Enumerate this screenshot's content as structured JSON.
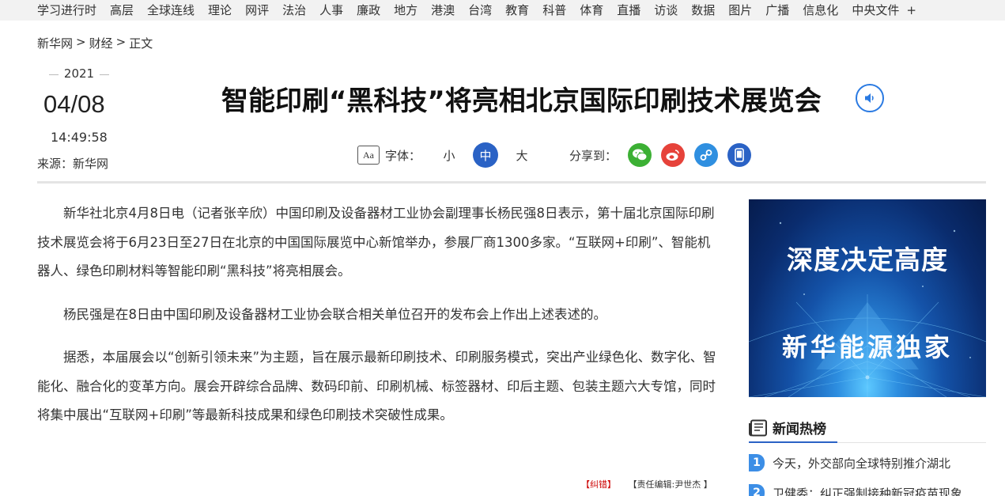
{
  "topnav": {
    "items": [
      "学习进行时",
      "高层",
      "全球连线",
      "理论",
      "网评",
      "法治",
      "人事",
      "廉政",
      "地方",
      "港澳",
      "台湾",
      "教育",
      "科普",
      "体育",
      "直播",
      "访谈",
      "数据",
      "图片",
      "广播",
      "信息化",
      "中央文件"
    ],
    "more": "+"
  },
  "breadcrumb": {
    "site": "新华网",
    "sep": ">",
    "section": "财经",
    "page": "正文"
  },
  "date": {
    "year": "2021",
    "month_day": "04/08",
    "time": "14:49:58"
  },
  "source": "来源：新华网",
  "headline": "智能印刷“黑科技”将亮相北京国际印刷技术展览会",
  "toolbar": {
    "font_label": "字体：",
    "sizes": [
      "小",
      "中",
      "大"
    ],
    "active_size": "中",
    "share_label": "分享到：",
    "share_icons": [
      "wechat-icon",
      "weibo-icon",
      "link-icon",
      "mobile-icon"
    ],
    "share_colors": [
      "#3cb034",
      "#e6423a",
      "#2f8fe0",
      "#2a62c5"
    ]
  },
  "article": {
    "paragraphs": [
      "新华社北京4月8日电（记者张辛欣）中国印刷及设备器材工业协会副理事长杨民强8日表示，第十届北京国际印刷技术展览会将于6月23日至27日在北京的中国国际展览中心新馆举办，参展厂商1300多家。“互联网+印刷”、智能机器人、绿色印刷材料等智能印刷“黑科技”将亮相展会。",
      "杨民强是在8日由中国印刷及设备器材工业协会联合相关单位召开的发布会上作出上述表述的。",
      "据悉，本届展会以“创新引领未来”为主题，旨在展示最新印刷技术、印刷服务模式，突出产业绿色化、数字化、智能化、融合化的变革方向。展会开辟综合品牌、数码印前、印刷机械、标签器材、印后主题、包装主题六大专馆，同时将集中展出“互联网+印刷”等最新科技成果和绿色印刷技术突破性成果。"
    ],
    "correction": "【纠错】",
    "editor": "【责任编辑:尹世杰 】"
  },
  "banner": {
    "line1": "深度决定高度",
    "line2": "新华能源独家"
  },
  "hot": {
    "title": "新闻热榜",
    "items": [
      {
        "rank": "1",
        "text": "今天，外交部向全球特别推介湖北"
      },
      {
        "rank": "2",
        "text": "卫健委：纠正强制接种新冠疫苗现象"
      }
    ]
  }
}
